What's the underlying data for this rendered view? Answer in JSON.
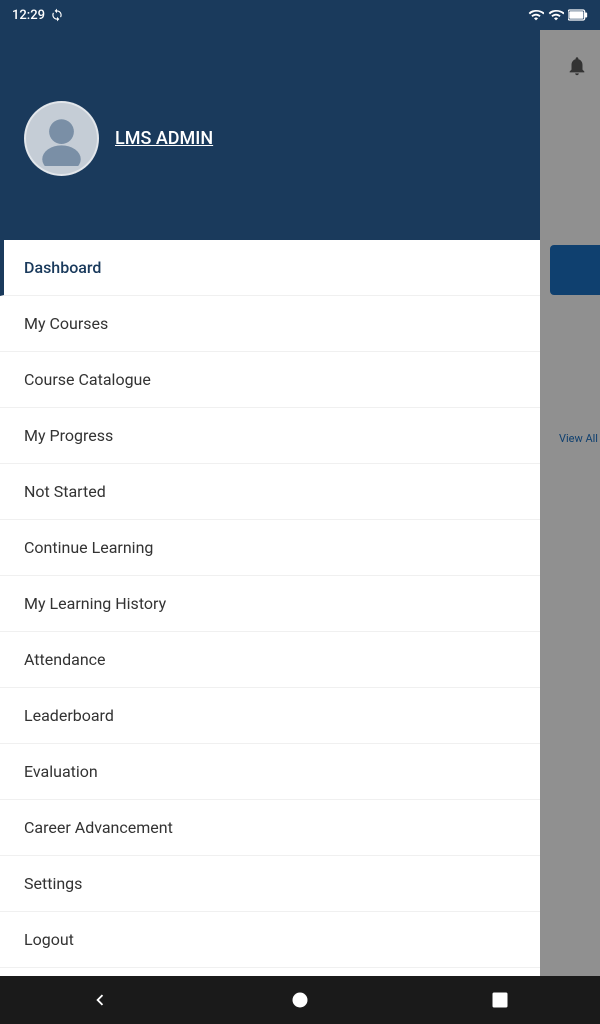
{
  "status_bar": {
    "time": "12:29",
    "icons": [
      "sync-icon",
      "wifi-icon",
      "signal-icon",
      "battery-icon"
    ]
  },
  "user": {
    "name": "LMS ADMIN"
  },
  "nav": {
    "items": [
      {
        "label": "Dashboard",
        "active": true
      },
      {
        "label": "My Courses",
        "active": false
      },
      {
        "label": "Course Catalogue",
        "active": false
      },
      {
        "label": "My Progress",
        "active": false
      },
      {
        "label": "Not Started",
        "active": false
      },
      {
        "label": "Continue Learning",
        "active": false
      },
      {
        "label": "My Learning History",
        "active": false
      },
      {
        "label": "Attendance",
        "active": false
      },
      {
        "label": "Leaderboard",
        "active": false
      },
      {
        "label": "Evaluation",
        "active": false
      },
      {
        "label": "Career Advancement",
        "active": false
      },
      {
        "label": "Settings",
        "active": false
      },
      {
        "label": "Logout",
        "active": false
      }
    ]
  },
  "background": {
    "view_all": "View All"
  },
  "bottom_nav": {
    "back_label": "◀",
    "home_label": "●",
    "square_label": "■"
  }
}
